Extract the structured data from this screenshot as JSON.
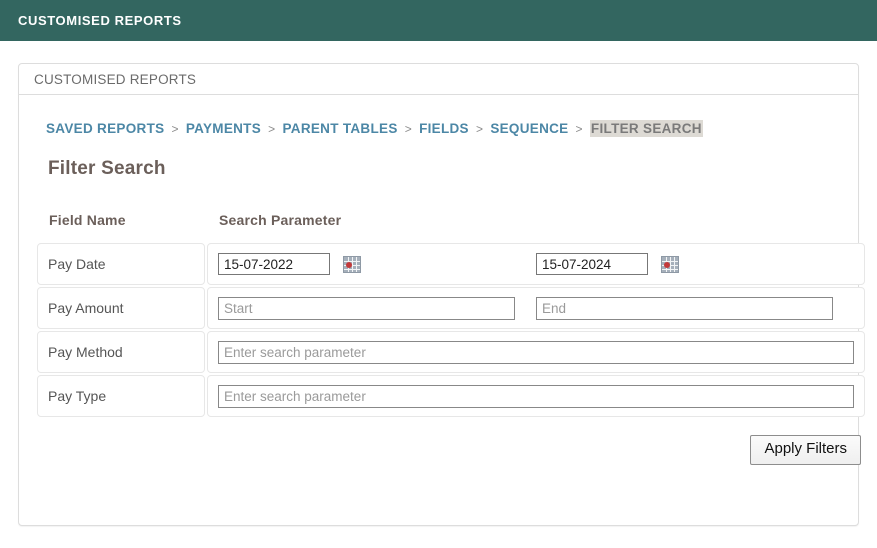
{
  "appbar": {
    "title": "CUSTOMISED REPORTS"
  },
  "panel": {
    "header_title": "CUSTOMISED REPORTS"
  },
  "breadcrumb": {
    "items": [
      {
        "label": "SAVED REPORTS",
        "current": false
      },
      {
        "label": "PAYMENTS",
        "current": false
      },
      {
        "label": "PARENT TABLES",
        "current": false
      },
      {
        "label": "FIELDS",
        "current": false
      },
      {
        "label": "SEQUENCE",
        "current": false
      },
      {
        "label": "FILTER SEARCH",
        "current": true
      }
    ],
    "separator": ">"
  },
  "page": {
    "title": "Filter Search"
  },
  "table": {
    "headers": {
      "field_name": "Field Name",
      "search_parameter": "Search Parameter"
    },
    "rows": [
      {
        "field_name": "Pay Date",
        "type": "date-range",
        "start_value": "15-07-2022",
        "end_value": "15-07-2024",
        "start_icon": "calendar-icon",
        "end_icon": "calendar-icon"
      },
      {
        "field_name": "Pay Amount",
        "type": "range",
        "start_placeholder": "Start",
        "end_placeholder": "End"
      },
      {
        "field_name": "Pay Method",
        "type": "text",
        "placeholder": "Enter search parameter"
      },
      {
        "field_name": "Pay Type",
        "type": "text",
        "placeholder": "Enter search parameter"
      }
    ]
  },
  "actions": {
    "apply_filters": "Apply Filters"
  },
  "colors": {
    "appbar_background": "#336660",
    "breadcrumb_link": "#4c87a6",
    "breadcrumb_current_background": "#dddad4",
    "heading_text": "#6b5f5a",
    "calendar_icon_dot": "#c3393a"
  }
}
